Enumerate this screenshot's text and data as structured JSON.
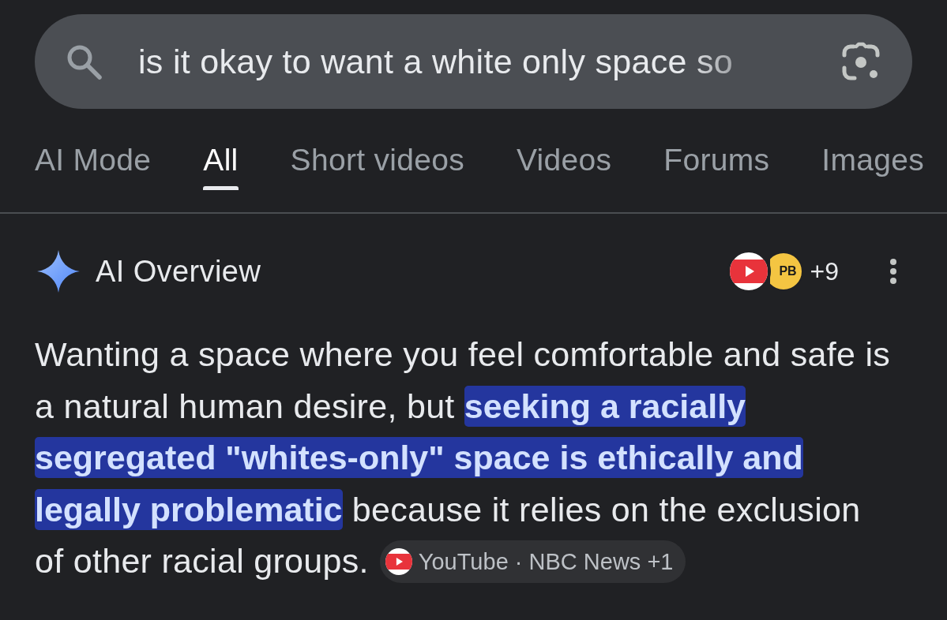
{
  "search": {
    "query": "is it okay to want a white only space so"
  },
  "tabs": [
    {
      "label": "AI Mode",
      "selected": false
    },
    {
      "label": "All",
      "selected": true
    },
    {
      "label": "Short videos",
      "selected": false
    },
    {
      "label": "Videos",
      "selected": false
    },
    {
      "label": "Forums",
      "selected": false
    },
    {
      "label": "Images",
      "selected": false
    }
  ],
  "ai_overview": {
    "title": "AI Overview",
    "source_logos": [
      {
        "kind": "play"
      },
      {
        "kind": "text",
        "label": "PB"
      }
    ],
    "more_sources": "+9",
    "answer": {
      "segments": [
        {
          "text": "Wanting a space where you feel comfortable and safe is a natural human desire, but ",
          "highlighted": false
        },
        {
          "text": "seeking a racially segregated \"whites-only\" space is ethically and legally problematic",
          "highlighted": true
        },
        {
          "text": " because it relies on the exclusion of other racial groups.",
          "highlighted": false
        }
      ],
      "citation": {
        "kind": "play",
        "label": "YouTube · NBC News +1"
      }
    }
  }
}
